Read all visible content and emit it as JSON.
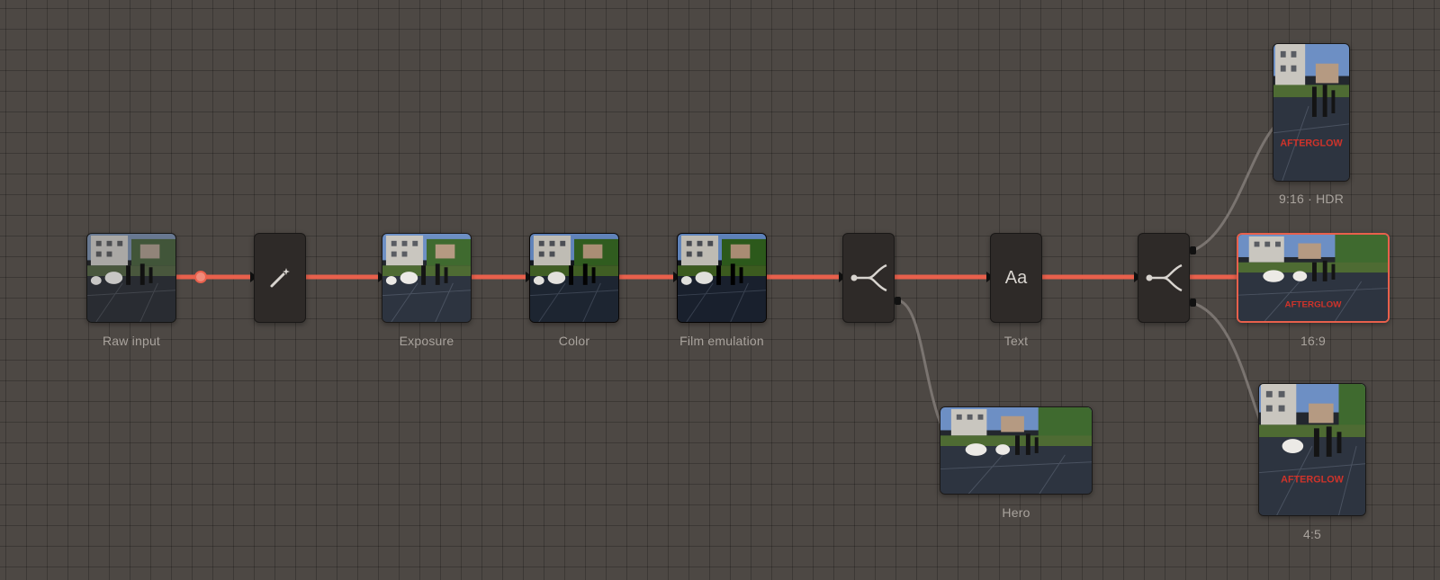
{
  "graph": {
    "nodes": [
      {
        "id": "raw-input",
        "label": "Raw input",
        "kind": "image"
      },
      {
        "id": "auto",
        "label": "",
        "kind": "tool",
        "icon": "magic-wand-icon"
      },
      {
        "id": "exposure",
        "label": "Exposure",
        "kind": "image"
      },
      {
        "id": "color",
        "label": "Color",
        "kind": "image"
      },
      {
        "id": "film-emulation",
        "label": "Film emulation",
        "kind": "image"
      },
      {
        "id": "split-1",
        "label": "",
        "kind": "tool",
        "icon": "branch-split-icon"
      },
      {
        "id": "text",
        "label": "Text",
        "kind": "tool",
        "icon": "text-icon",
        "icon_text": "Aa"
      },
      {
        "id": "split-2",
        "label": "",
        "kind": "tool",
        "icon": "branch-split-icon"
      },
      {
        "id": "out-9-16",
        "label": "9:16 · HDR",
        "kind": "output",
        "overlay_text": "AFTERGLOW"
      },
      {
        "id": "out-16-9",
        "label": "16:9",
        "kind": "output",
        "overlay_text": "AFTERGLOW",
        "selected": true
      },
      {
        "id": "out-hero",
        "label": "Hero",
        "kind": "output"
      },
      {
        "id": "out-4-5",
        "label": "4:5",
        "kind": "output",
        "overlay_text": "AFTERGLOW"
      }
    ],
    "colors": {
      "canvas": "#4d4844",
      "active_wire": "#e8604c",
      "inactive_wire": "#7a7470",
      "node_fill": "#2e2a28",
      "selection": "#e8604c"
    }
  }
}
